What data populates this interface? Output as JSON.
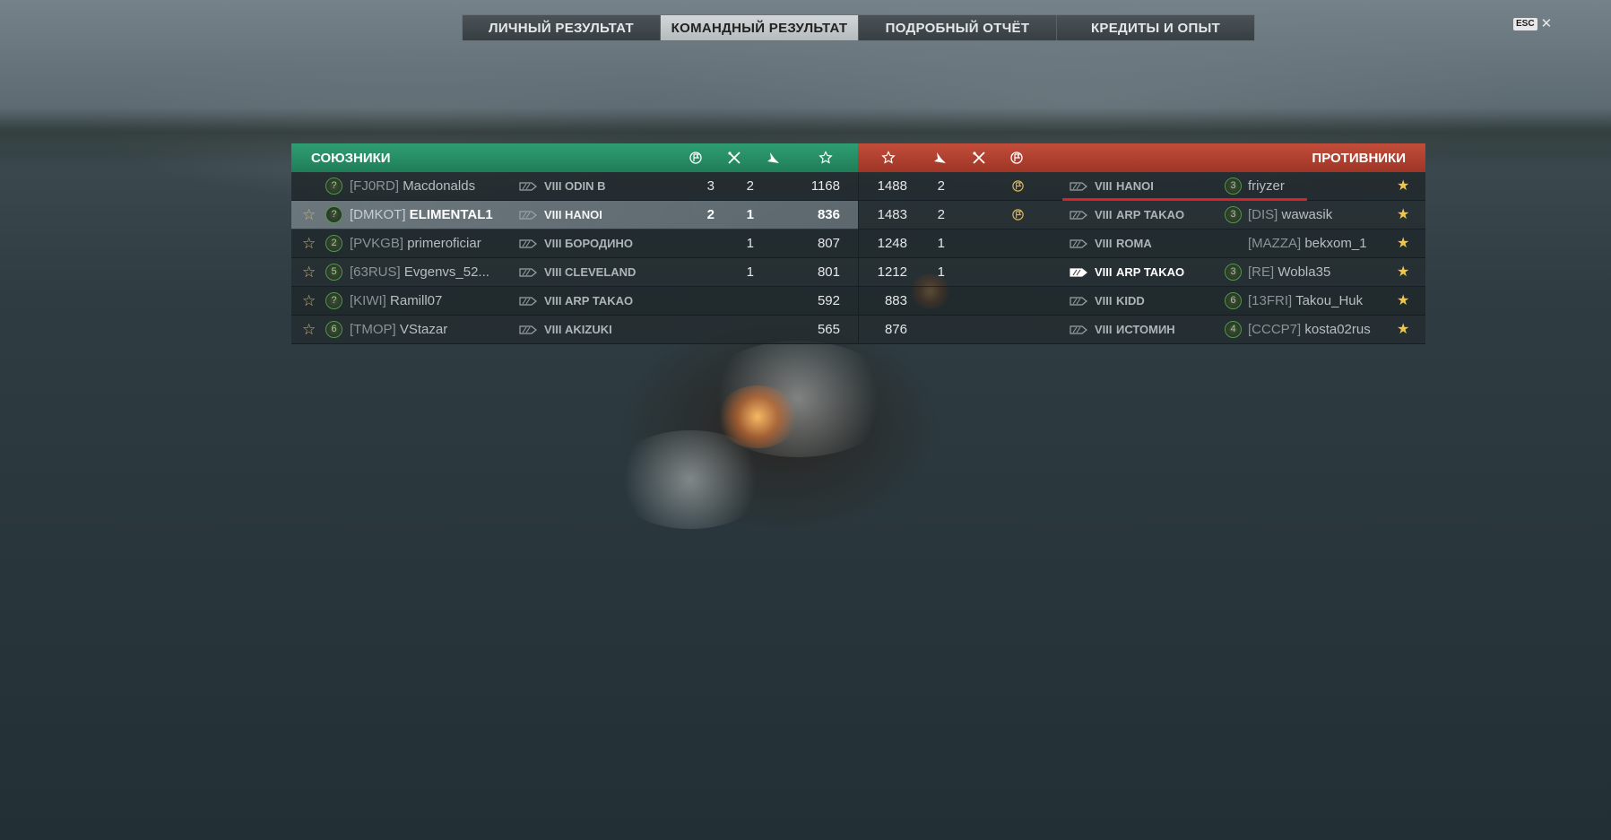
{
  "tabs": [
    {
      "label": "ЛИЧНЫЙ РЕЗУЛЬТАТ",
      "active": false
    },
    {
      "label": "КОМАНДНЫЙ РЕЗУЛЬТАТ",
      "active": true
    },
    {
      "label": "ПОДРОБНЫЙ ОТЧЁТ",
      "active": false
    },
    {
      "label": "КРЕДИТЫ И ОПЫТ",
      "active": false
    }
  ],
  "close": {
    "key_label": "ESC",
    "close_glyph": "✕"
  },
  "allies": {
    "title": "СОЮЗНИКИ",
    "color": "#27916a",
    "header_icons": [
      "base-capture-icon",
      "ships-destroyed-icon",
      "planes-destroyed-icon",
      "experience-star-icon"
    ],
    "rows": [
      {
        "star": "",
        "rank": "?",
        "clan": "[FJ0RD]",
        "player": "Macdonalds",
        "tier": "VIII",
        "ship": "ODIN B",
        "kills": "3",
        "planes": "2",
        "xp": "1168",
        "highlight": false
      },
      {
        "star": "☆",
        "rank": "?",
        "clan": "[DMKOT]",
        "player": "ELIMENTAL1",
        "tier": "VIII",
        "ship": "HANOI",
        "kills": "2",
        "planes": "1",
        "xp": "836",
        "highlight": true
      },
      {
        "star": "☆",
        "rank": "2",
        "clan": "[PVKGB]",
        "player": "primeroficiar",
        "tier": "VIII",
        "ship": "БОРОДИНО",
        "kills": "",
        "planes": "1",
        "xp": "807",
        "highlight": false
      },
      {
        "star": "☆",
        "rank": "5",
        "clan": "[63RUS]",
        "player": "Evgenvs_52...",
        "tier": "VIII",
        "ship": "CLEVELAND",
        "kills": "",
        "planes": "1",
        "xp": "801",
        "highlight": false
      },
      {
        "star": "☆",
        "rank": "?",
        "clan": "[KIWI]",
        "player": "Ramill07",
        "tier": "VIII",
        "ship": "ARP TAKAO",
        "kills": "",
        "planes": "",
        "xp": "592",
        "highlight": false
      },
      {
        "star": "☆",
        "rank": "6",
        "clan": "[TMOP]",
        "player": "VStazar",
        "tier": "VIII",
        "ship": "AKIZUKI",
        "kills": "",
        "planes": "",
        "xp": "565",
        "highlight": false
      }
    ]
  },
  "enemies": {
    "title": "ПРОТИВНИКИ",
    "color": "#b34232",
    "header_icons": [
      "experience-star-icon",
      "planes-destroyed-icon",
      "ships-destroyed-icon",
      "base-capture-icon"
    ],
    "rows": [
      {
        "xp": "1488",
        "planes": "2",
        "kills": "",
        "capture": true,
        "tier": "VIII",
        "ship": "HANOI",
        "rank": "3",
        "clan": "",
        "player": "friyzer",
        "star": "★",
        "bright": false
      },
      {
        "xp": "1483",
        "planes": "2",
        "kills": "",
        "capture": true,
        "tier": "VIII",
        "ship": "ARP TAKAO",
        "rank": "3",
        "clan": "[DIS]",
        "player": "wawasik",
        "star": "★",
        "bright": false
      },
      {
        "xp": "1248",
        "planes": "1",
        "kills": "",
        "capture": false,
        "tier": "VIII",
        "ship": "ROMA",
        "rank": "",
        "clan": "[MAZZA]",
        "player": "bekxom_1",
        "star": "★",
        "bright": false
      },
      {
        "xp": "1212",
        "planes": "1",
        "kills": "",
        "capture": false,
        "tier": "VIII",
        "ship": "ARP TAKAO",
        "rank": "3",
        "clan": "[RE]",
        "player": "Wobla35",
        "star": "★",
        "bright": true
      },
      {
        "xp": "883",
        "planes": "",
        "kills": "",
        "capture": false,
        "tier": "VIII",
        "ship": "KIDD",
        "rank": "6",
        "clan": "[13FRI]",
        "player": "Takou_Huk",
        "star": "★",
        "bright": false
      },
      {
        "xp": "876",
        "planes": "",
        "kills": "",
        "capture": false,
        "tier": "VIII",
        "ship": "ИСТОМИН",
        "rank": "4",
        "clan": "[CCCP7]",
        "player": "kosta02rus",
        "star": "★",
        "bright": false
      }
    ]
  },
  "annotation": {
    "color": "#d8232a"
  }
}
